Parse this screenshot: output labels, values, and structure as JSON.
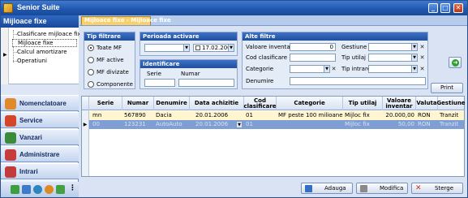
{
  "app": {
    "title": "Senior Suite"
  },
  "window_controls": {
    "minimize": "_",
    "maximize": "□",
    "close": "✕"
  },
  "left": {
    "header": "Mijloace fixe",
    "tree": [
      {
        "label": "Clasificare mijloace fixe"
      },
      {
        "label": "Mijloace fixe"
      },
      {
        "label": "Calcul amortizare"
      },
      {
        "label": "Operatiuni"
      }
    ],
    "nav": [
      {
        "label": "Nomenclatoare",
        "icon": "pencil-icon",
        "color": "#e08a2c"
      },
      {
        "label": "Service",
        "icon": "wrench-icon",
        "color": "#d4462a"
      },
      {
        "label": "Vanzari",
        "icon": "cart-icon",
        "color": "#3a8c3a"
      },
      {
        "label": "Administrare",
        "icon": "admin-icon",
        "color": "#c63b3b"
      },
      {
        "label": "Intrari",
        "icon": "box-icon",
        "color": "#c23a3a"
      }
    ],
    "mini_icons": [
      {
        "icon": "green-arrow-icon",
        "color": "#3f9e3f"
      },
      {
        "icon": "blue-gear-icon",
        "color": "#3d7ac8"
      },
      {
        "icon": "globe-icon",
        "color": "#2c87c0"
      },
      {
        "icon": "orange-gear-icon",
        "color": "#dd8a25"
      },
      {
        "icon": "green-box-icon",
        "color": "#44a044"
      }
    ],
    "overflow": "⋮"
  },
  "tab": {
    "label": "Mijloace fixe - Mijloace fixe"
  },
  "tip_filtrare": {
    "title": "Tip filtrare",
    "options": [
      {
        "label": "Toate MF",
        "selected": true
      },
      {
        "label": "MF active",
        "selected": false
      },
      {
        "label": "MF divizate",
        "selected": false
      },
      {
        "label": "Componente",
        "selected": false
      }
    ]
  },
  "perioada": {
    "title": "Perioada activare",
    "from": "",
    "to": "17.02.2006"
  },
  "identificare": {
    "title": "Identificare",
    "serie_label": "Serie",
    "numar_label": "Numar",
    "serie": "",
    "numar": ""
  },
  "alte_filtre": {
    "title": "Alte filtre",
    "valoare_inventar_label": "Valoare inventar",
    "valoare_inventar": "0",
    "cod_clasificare_label": "Cod clasificare",
    "cod_clasificare": "",
    "categorie_label": "Categorie",
    "categorie": "",
    "denumire_label": "Denumire",
    "denumire": "",
    "gestiune_label": "Gestiune",
    "gestiune": "",
    "tip_utilaj_label": "Tip utilaj",
    "tip_utilaj": "",
    "tip_intrare_label": "Tip intrare",
    "tip_intrare": "",
    "clear": "✕",
    "print": "Print"
  },
  "refresh": {
    "symbol": "➜"
  },
  "grid": {
    "columns": [
      "Serie",
      "Numar",
      "Denumire",
      "Data achizitie",
      "Cod clasificare",
      "Categorie",
      "Tip utilaj",
      "Valoare inventar",
      "Valuta",
      "Gestiune"
    ],
    "rows": [
      {
        "serie": "mn",
        "numar": "567890",
        "denumire": "Dacia",
        "data": "20.01.2006",
        "cod": "01",
        "categorie": "MF peste 100 milioane",
        "tip": "Mijloc fix",
        "valoare": "20.000,00",
        "valuta": "RON",
        "gestiune": "Tranzit"
      },
      {
        "serie": "00",
        "numar": "123231",
        "denumire": "AutoAuto",
        "data": "20.01.2006",
        "cod": "01",
        "categorie": "",
        "tip": "Mijloc fix",
        "valoare": "50,00",
        "valuta": "RON",
        "gestiune": "Tranzit"
      }
    ],
    "row_marker": "▶"
  },
  "actions": {
    "adauga": "Adauga",
    "modifica": "Modifica",
    "sterge": "Sterge"
  },
  "colors": {
    "selected_row": "#fff6d0",
    "editing_row": "#7f9fd4"
  }
}
